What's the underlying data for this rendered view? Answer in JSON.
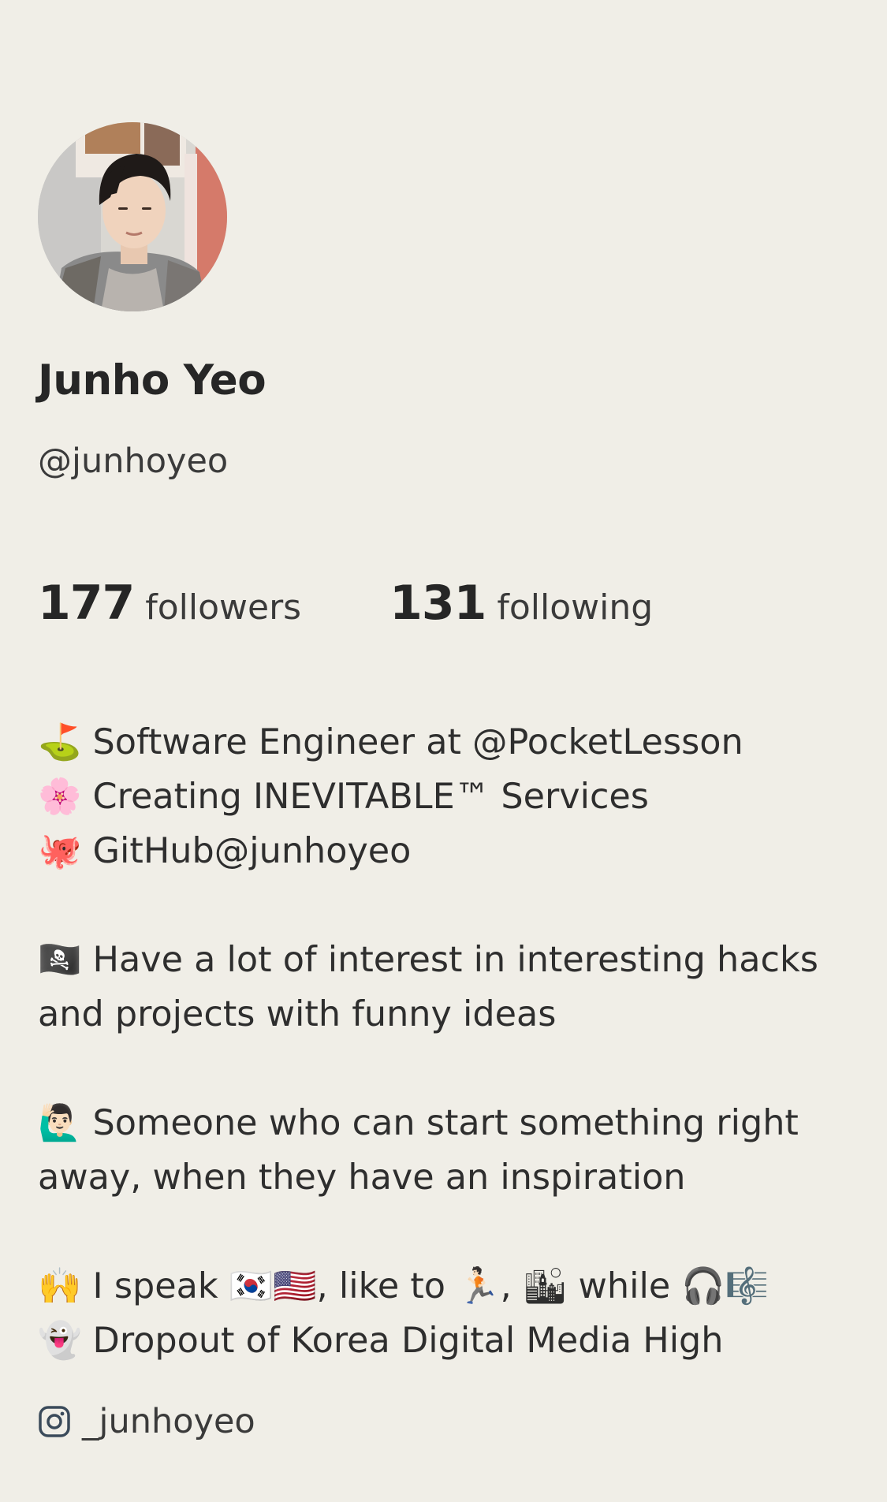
{
  "profile": {
    "display_name": "Junho Yeo",
    "handle": "@junhoyeo",
    "avatar_icon": "avatar-photo"
  },
  "stats": {
    "followers_count": "177",
    "followers_label": "followers",
    "following_count": "131",
    "following_label": "following"
  },
  "bio": {
    "line1": "⛳️ Software Engineer at @PocketLesson",
    "line2": "🌸 Creating INEVITABLE™ Services",
    "line3": "🐙 GitHub@junhoyeo",
    "para1": "🏴‍☠️ Have a lot of interest in interesting hacks and projects with funny ideas",
    "para2": "🙋🏻‍♂️ Someone who can start something right away, when they have an inspiration",
    "line4": "🙌 I speak 🇰🇷🇺🇸, like to 🏃🏻, 🏙 while 🎧🎼",
    "line5": "👻 Dropout of Korea Digital Media High"
  },
  "links": {
    "instagram_icon": "instagram-icon",
    "instagram_handle": "_junhoyeo"
  },
  "colors": {
    "background": "#f0eee7",
    "text_primary": "#262626",
    "text_secondary": "#3a3a3a"
  }
}
